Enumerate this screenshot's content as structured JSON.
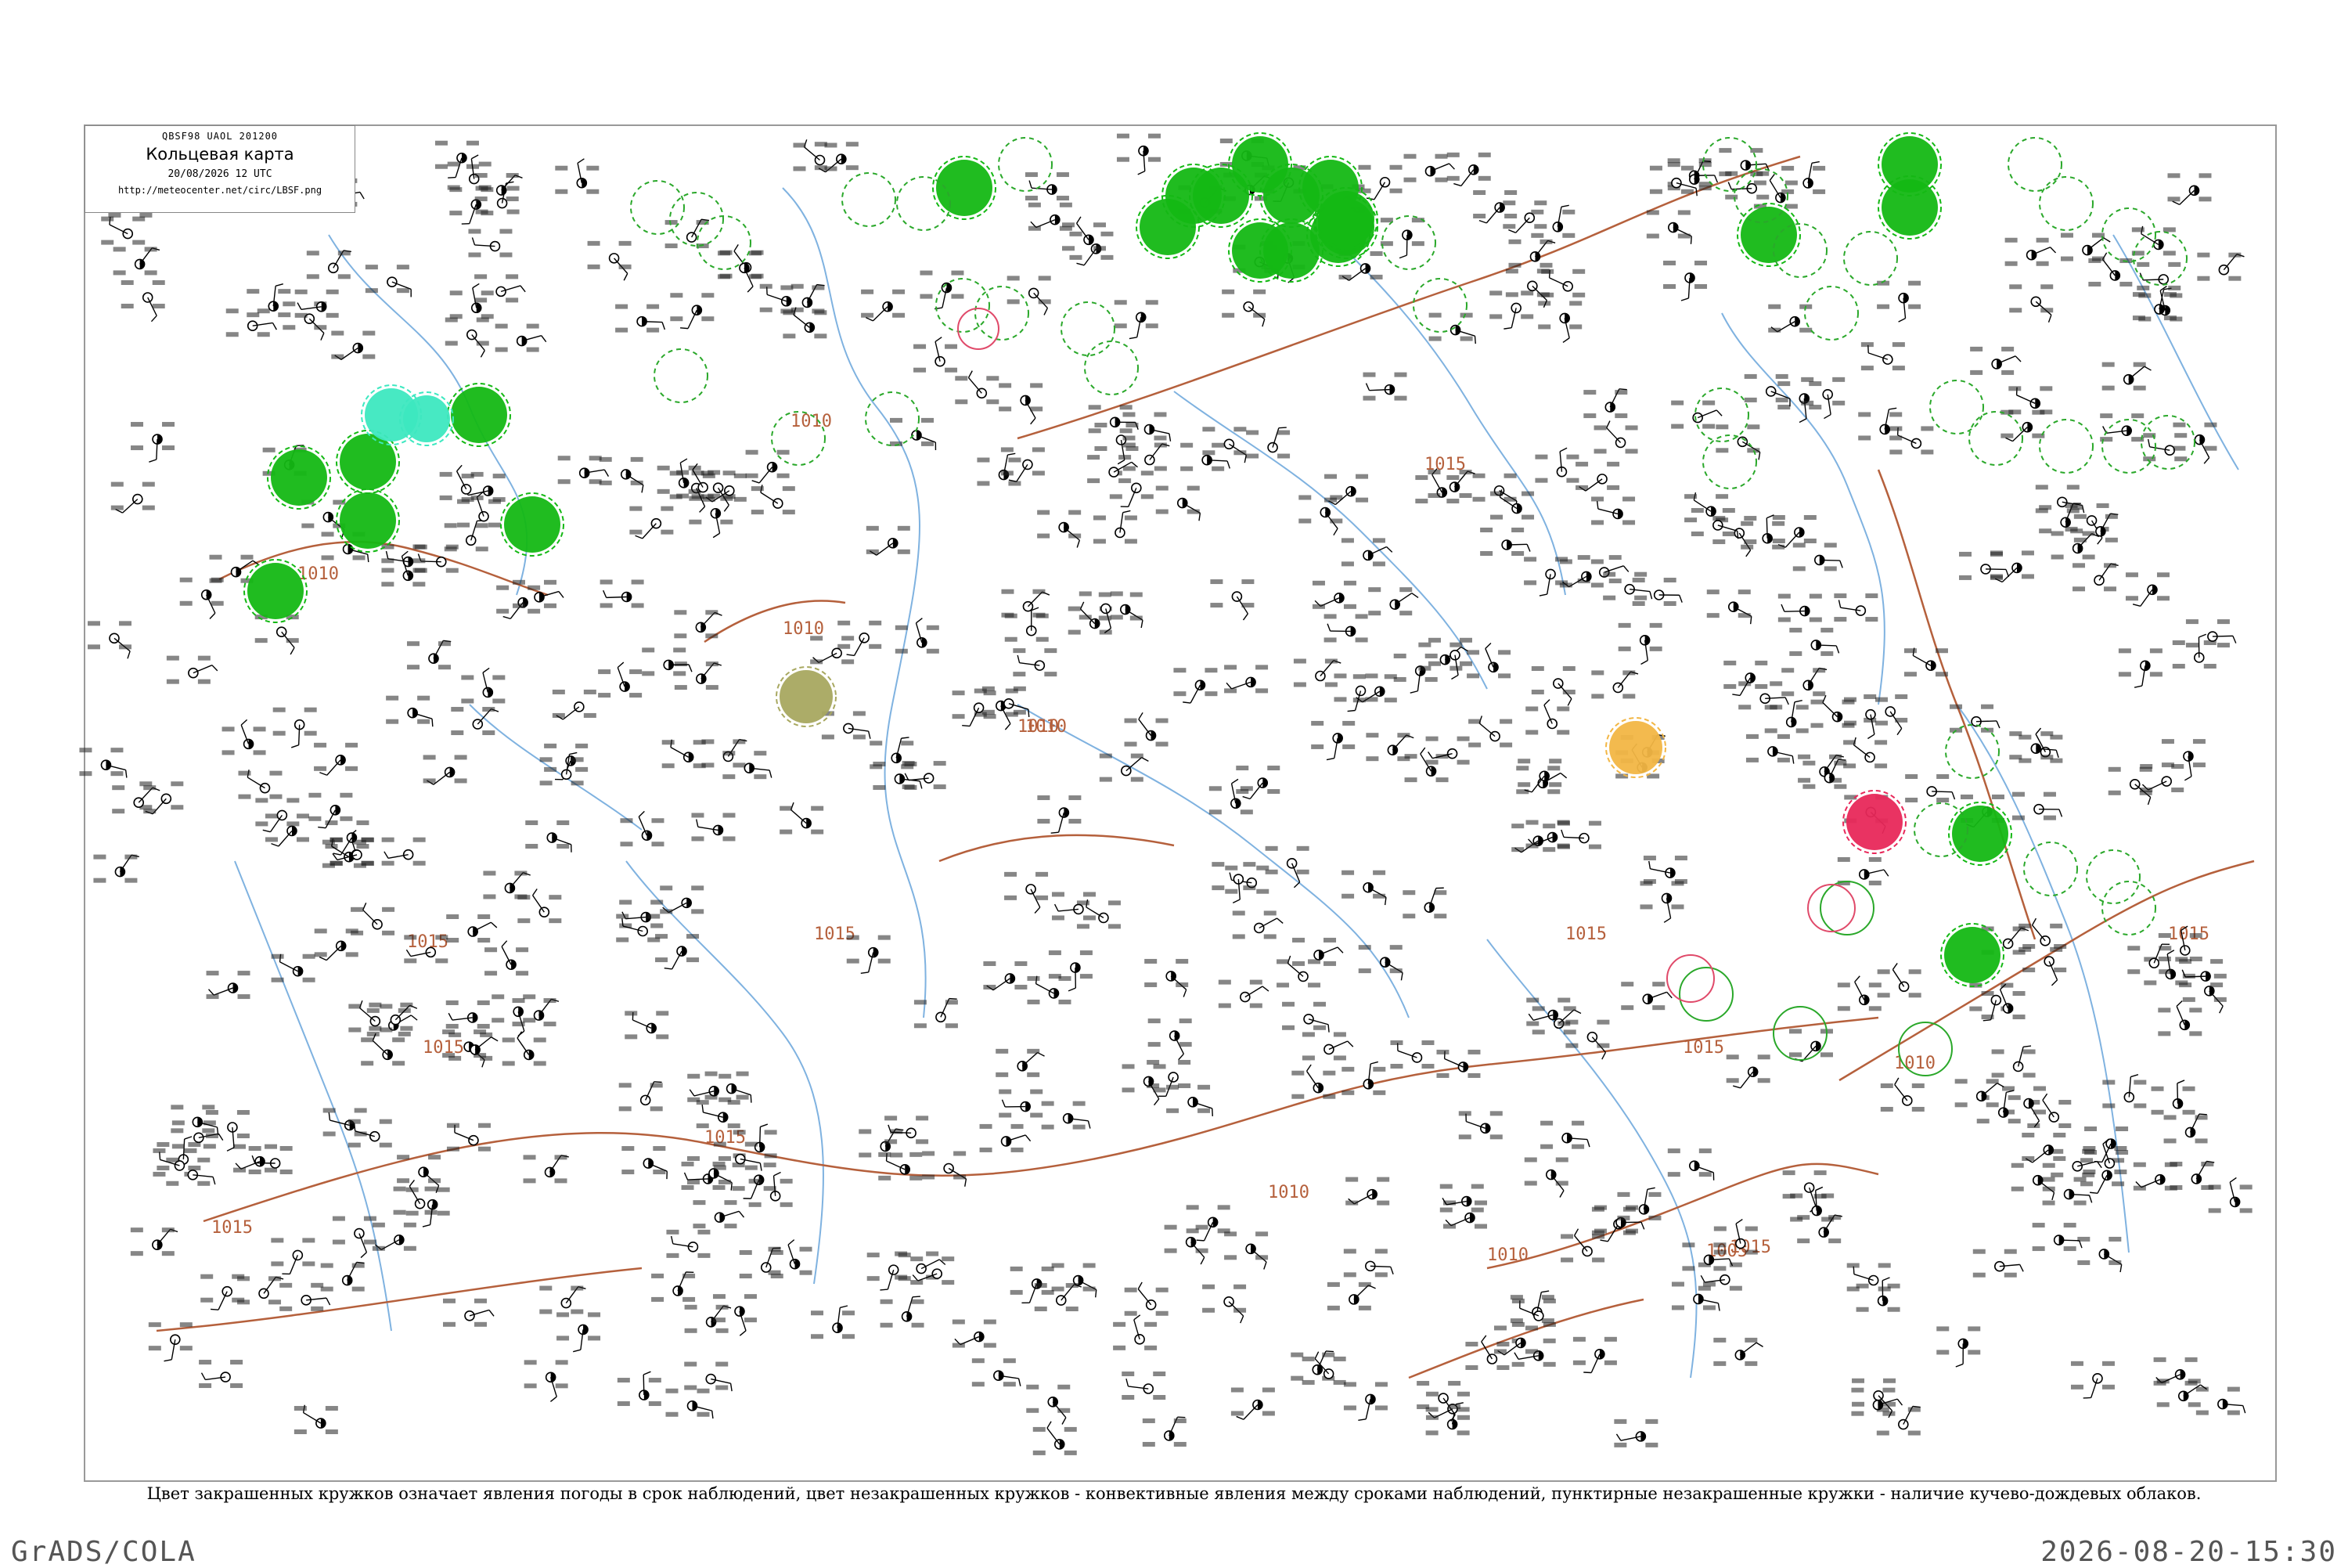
{
  "title_box": {
    "code": "QBSF98  UAOL  201200",
    "title": "Кольцевая карта",
    "date": "20/08/2026 12 UTC",
    "url": "http://meteocenter.net/circ/LBSF.png"
  },
  "caption": "Цвет закрашенных кружков означает явления погоды в срок наблюдений, цвет незакрашенных кружков - конвективные явления между сроками наблюдений, пунктирные незакрашенные кружки - наличие кучево-дождевых облаков.",
  "footer": {
    "left": "GrADS/COLA",
    "right": "2026-08-20-15:30"
  },
  "isobar_labels": [
    "1010",
    "1010",
    "1010",
    "1010",
    "1015",
    "1015",
    "1015",
    "1010",
    "1015",
    "1015",
    "1015",
    "1005",
    "1015",
    "1010",
    "1010",
    "1010",
    "1015",
    "1015",
    "1015"
  ],
  "colors": {
    "isobar": "#b5603c",
    "rivers": "#7fb2e0",
    "rain_fill": "#14b814",
    "ts_fill": "#e8285a",
    "fog_fill": "#f2b644",
    "dust_fill": "#a8a860",
    "drizzle_fill": "#3de8c0",
    "convective_ring": "#2aa82a",
    "ts_ring": "#e04a6a"
  },
  "legend_colors": [
    "rain_fill",
    "ts_fill",
    "fog_fill",
    "dust_fill",
    "drizzle_fill"
  ]
}
